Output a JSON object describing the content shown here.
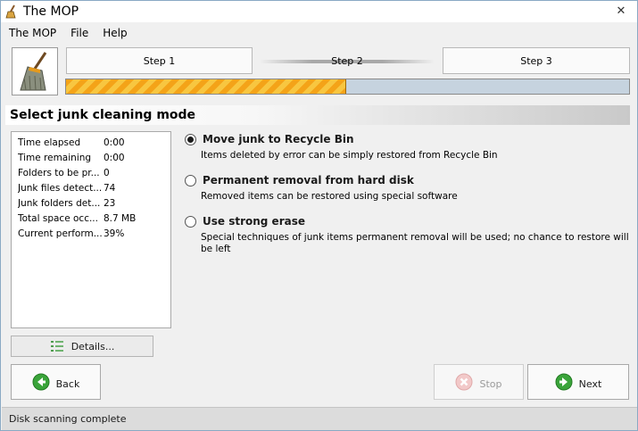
{
  "window": {
    "title": "The MOP",
    "close_symbol": "✕"
  },
  "menu": [
    "The MOP",
    "File",
    "Help"
  ],
  "steps": [
    {
      "label": "Step 1",
      "active": false
    },
    {
      "label": "Step 2",
      "active": true
    },
    {
      "label": "Step 3",
      "active": false
    }
  ],
  "progress": {
    "fraction": 0.498
  },
  "section": {
    "title": "Select junk cleaning mode"
  },
  "stats": [
    {
      "label": "Time elapsed",
      "value": "0:00"
    },
    {
      "label": "Time remaining",
      "value": "0:00"
    },
    {
      "label": "Folders to be pr...",
      "value": "0"
    },
    {
      "label": "Junk files detect...",
      "value": "74"
    },
    {
      "label": "Junk folders det...",
      "value": "23"
    },
    {
      "label": "Total space occ...",
      "value": "8.7 MB"
    },
    {
      "label": "Current perform...",
      "value": "39%"
    }
  ],
  "details_button": {
    "label": "Details..."
  },
  "options": [
    {
      "title": "Move junk to Recycle Bin",
      "desc": "Items deleted by error can be simply restored from Recycle Bin",
      "selected": true
    },
    {
      "title": "Permanent removal from hard disk",
      "desc": "Removed items can be restored using special software",
      "selected": false
    },
    {
      "title": "Use strong erase",
      "desc": "Special techniques of junk items permanent removal will be used; no chance to restore will be left",
      "selected": false
    }
  ],
  "buttons": {
    "back": "Back",
    "stop": "Stop",
    "next": "Next"
  },
  "status": "Disk scanning complete",
  "colors": {
    "progress_fill": "#f4a318",
    "progress_track": "#c6d3df",
    "nav_icon_green": "#3aa43a"
  },
  "icons": {
    "app": "broom-icon",
    "details": "list-icon",
    "back": "arrow-left-circle-icon",
    "stop": "stop-circle-icon",
    "next": "arrow-right-circle-icon"
  }
}
